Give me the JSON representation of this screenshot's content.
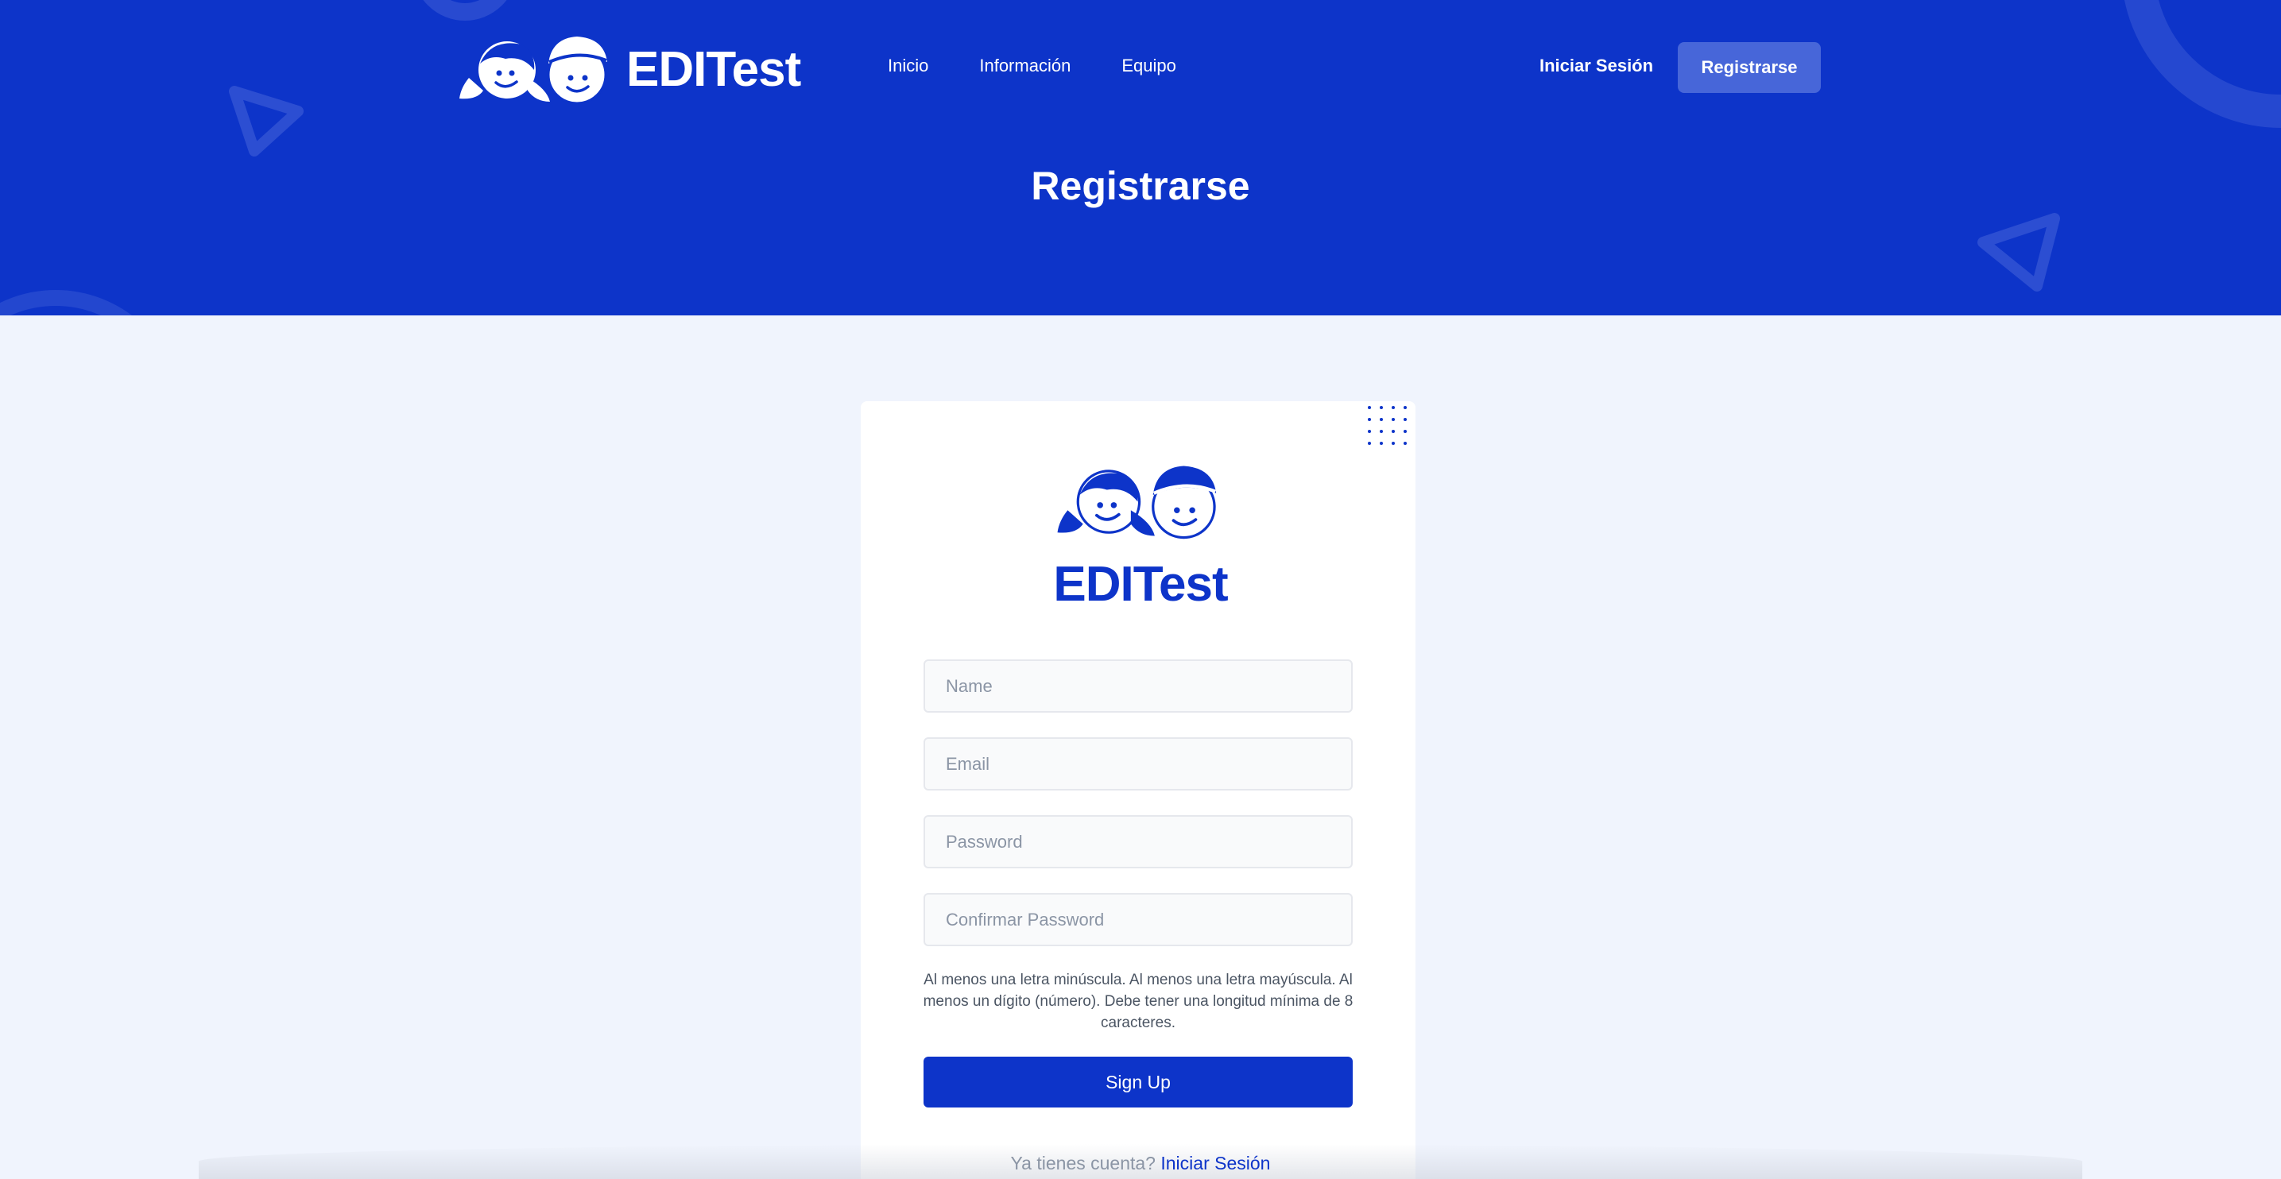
{
  "colors": {
    "primary": "#0d34c9",
    "background": "#f0f4fd",
    "register_button": "#4766d9"
  },
  "header": {
    "brand": "EDITest",
    "nav": [
      "Inicio",
      "Información",
      "Equipo"
    ],
    "login_label": "Iniciar Sesión",
    "register_label": "Registrarse"
  },
  "hero": {
    "title": "Registrarse"
  },
  "card": {
    "brand": "EDITest",
    "fields": {
      "name_placeholder": "Name",
      "email_placeholder": "Email",
      "password_placeholder": "Password",
      "confirm_placeholder": "Confirmar Password"
    },
    "hint": "Al menos una letra minúscula. Al menos una letra mayúscula. Al menos un dígito (número). Debe tener una longitud mínima de 8 caracteres.",
    "submit_label": "Sign Up",
    "footer_text": "Ya tienes cuenta?",
    "footer_link": "Iniciar Sesión"
  }
}
